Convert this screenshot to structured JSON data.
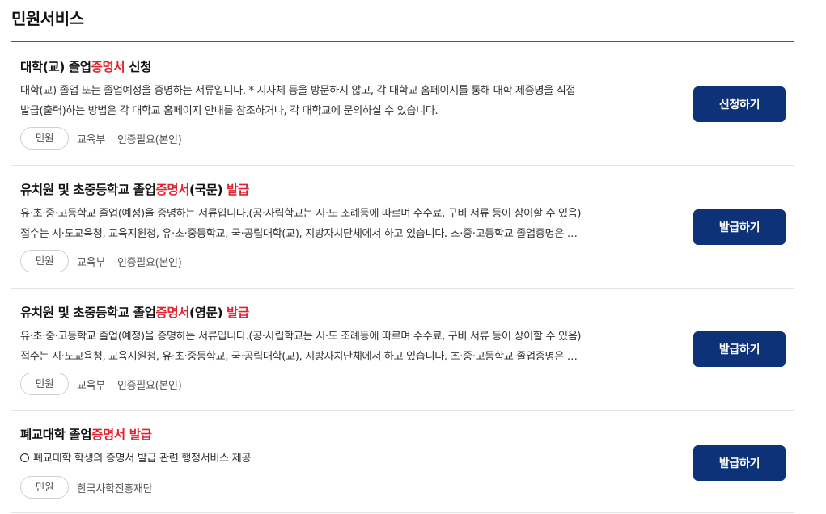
{
  "section": {
    "title": "민원서비스"
  },
  "items": [
    {
      "title_pre": "대학(교) 졸업",
      "title_hl": "증명서",
      "title_post": " 신청",
      "desc_line1": "대학(교) 졸업 또는 졸업예정을 증명하는 서류입니다. * 지자체 등을 방문하지 않고, 각 대학교 홈페이지를 통해 대학 제증명을 직접",
      "desc_line2": "발급(출력)하는 방법은 각 대학교 홈페이지 안내를 참조하거나, 각 대학교에 문의하실 수 있습니다.",
      "badge": "민원",
      "agency": "교육부",
      "auth": "인증필요(본인)",
      "button": "신청하기"
    },
    {
      "title_pre": "유치원 및 초중등학교 졸업",
      "title_hl": "증명서",
      "title_post": "(국문) ",
      "title_hl2": "발급",
      "desc_line1": "유·초·중·고등학교 졸업(예정)을 증명하는 서류입니다.(공·사립학교는 시·도 조례등에 따르며 수수료, 구비 서류 등이 상이할 수 있음)",
      "desc_line2": "접수는 시·도교육청, 교육지원청, 유·초·중등학교, 국·공립대학(교), 지방자치단체에서 하고 있습니다. 초·중·고등학교 졸업증명은 …",
      "badge": "민원",
      "agency": "교육부",
      "auth": "인증필요(본인)",
      "button": "발급하기"
    },
    {
      "title_pre": "유치원 및 초중등학교 졸업",
      "title_hl": "증명서",
      "title_post": "(영문) ",
      "title_hl2": "발급",
      "desc_line1": "유·초·중·고등학교 졸업(예정)을 증명하는 서류입니다.(공·사립학교는 시·도 조례등에 따르며 수수료, 구비 서류 등이 상이할 수 있음)",
      "desc_line2": "접수는 시·도교육청, 교육지원청, 유·초·중등학교, 국·공립대학(교), 지방자치단체에서 하고 있습니다. 초·중·고등학교 졸업증명은 …",
      "badge": "민원",
      "agency": "교육부",
      "auth": "인증필요(본인)",
      "button": "발급하기"
    },
    {
      "title_pre": "폐교대학 졸업",
      "title_hl": "증명서 발급",
      "desc_line1": "폐교대학 학생의 증명서 발급 관련 행정서비스 제공",
      "badge": "민원",
      "agency": "한국사학진흥재단",
      "button": "발급하기"
    }
  ],
  "colors": {
    "highlight": "#e0242e",
    "button": "#0d3278"
  }
}
